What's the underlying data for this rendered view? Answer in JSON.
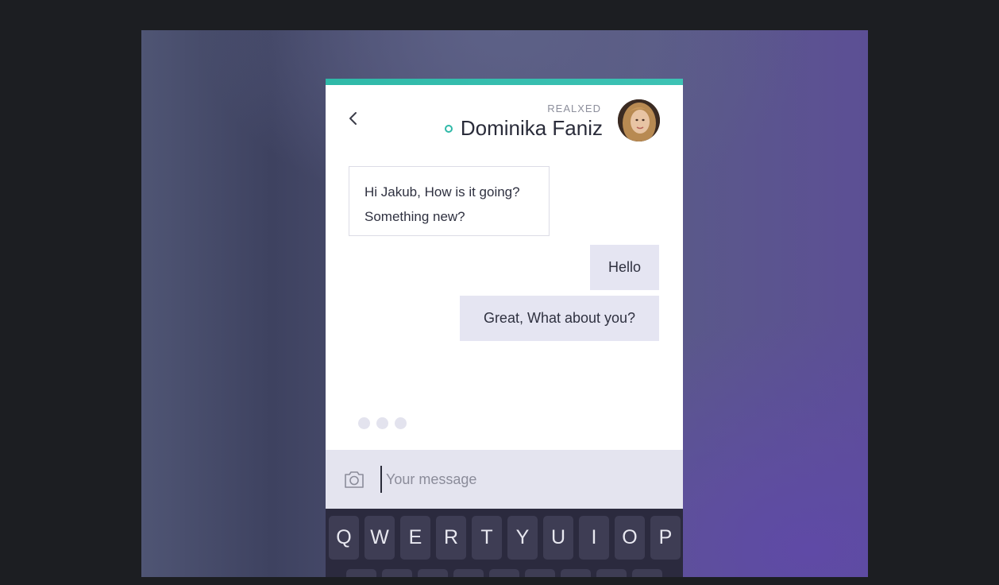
{
  "header": {
    "status": "REALXED",
    "contact_name": "Dominika Faniz"
  },
  "messages": {
    "incoming": {
      "line1": "Hi Jakub, How is it going?",
      "line2": "Something new?"
    },
    "outgoing": [
      "Hello",
      "Great, What about you?"
    ]
  },
  "composer": {
    "placeholder": "Your message"
  },
  "keyboard": {
    "row1": [
      "Q",
      "W",
      "E",
      "R",
      "T",
      "Y",
      "U",
      "I",
      "O",
      "P"
    ]
  },
  "colors": {
    "accent": "#2fb9a8",
    "bubble_out": "#e5e5f2",
    "composer_bg": "#e4e4ef",
    "keyboard_bg": "#2b2a3e"
  },
  "icons": {
    "back": "chevron-left-icon",
    "online": "online-status-icon",
    "camera": "camera-icon"
  }
}
